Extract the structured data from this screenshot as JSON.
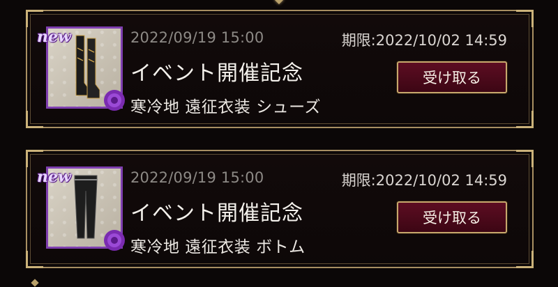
{
  "colors": {
    "background": "#0b0707",
    "frame_gold": "#a88f62",
    "button_maroon": "#5d0d22",
    "badge_purple": "#7f3fb0"
  },
  "notices": [
    {
      "badge": "new",
      "date": "2022/09/19 15:00",
      "deadline": "期限:2022/10/02 14:59",
      "title": "イベント開催記念",
      "subtitle": "寒冷地 遠征衣装 シューズ",
      "button_label": "受け取る",
      "item_icon": "boots-icon"
    },
    {
      "badge": "new",
      "date": "2022/09/19 15:00",
      "deadline": "期限:2022/10/02 14:59",
      "title": "イベント開催記念",
      "subtitle": "寒冷地 遠征衣装 ボトム",
      "button_label": "受け取る",
      "item_icon": "pants-icon"
    }
  ]
}
